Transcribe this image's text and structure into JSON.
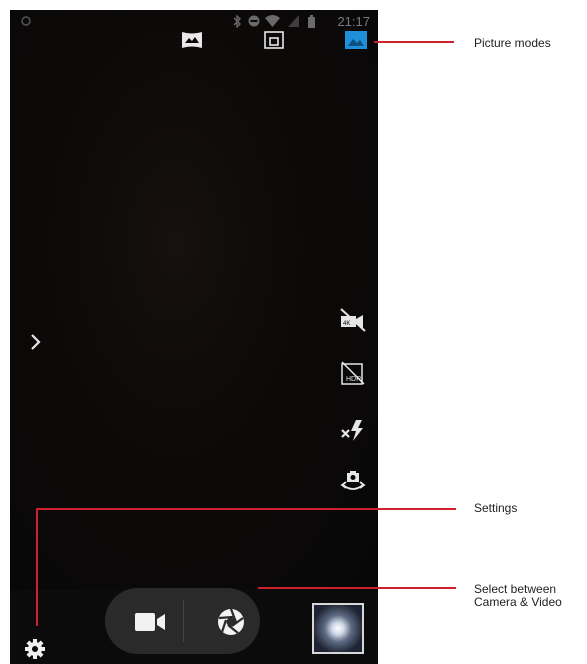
{
  "status_bar": {
    "time": "21:17",
    "icons": [
      "notification-icon",
      "bluetooth-icon",
      "do-not-disturb-icon",
      "wifi-icon",
      "mobile-signal-icon",
      "battery-icon"
    ]
  },
  "top_modes": [
    "panorama-icon",
    "picture-in-picture-icon",
    "picture-mode-icon"
  ],
  "side_controls": [
    "video-quality-off-icon",
    "hdr-off-icon",
    "flash-off-icon",
    "switch-camera-icon"
  ],
  "bottom_controls": [
    "settings-icon",
    "video-camera-icon",
    "shutter-icon",
    "gallery-thumbnail"
  ],
  "callouts": {
    "picture_modes": "Picture modes",
    "settings": "Settings",
    "select_line1": "Select between",
    "select_line2": "Camera & Video"
  },
  "colors": {
    "accent": "#1e8fd8",
    "callout_red": "#d0202a",
    "background": "#080808"
  }
}
